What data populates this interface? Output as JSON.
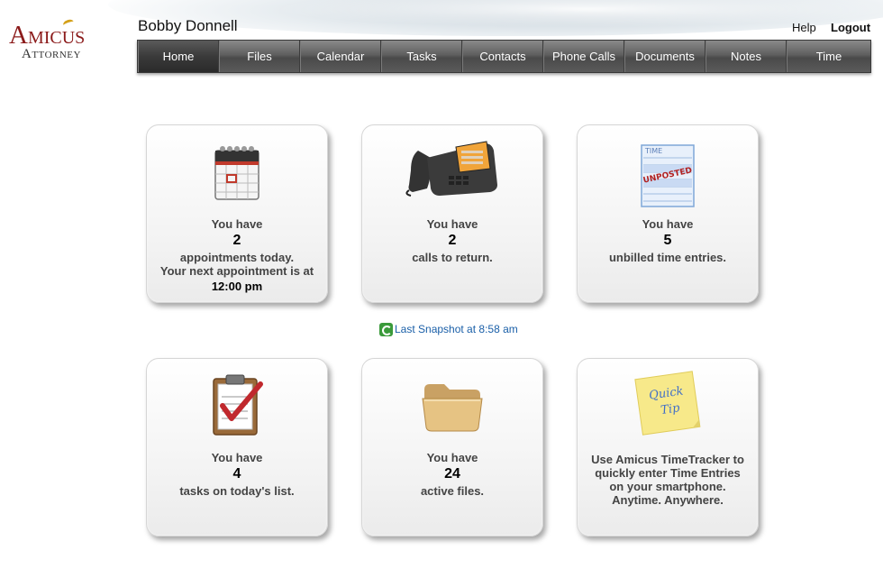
{
  "brand": {
    "logo_top": "Amicus",
    "logo_bottom": "Attorney"
  },
  "header": {
    "user_name": "Bobby Donnell",
    "help_label": "Help",
    "logout_label": "Logout"
  },
  "nav": {
    "active": "Home",
    "items": [
      "Home",
      "Files",
      "Calendar",
      "Tasks",
      "Contacts",
      "Phone Calls",
      "Documents",
      "Notes",
      "Time"
    ]
  },
  "cards": {
    "appointments": {
      "line1": "You have",
      "count": "2",
      "line2": "appointments today.",
      "line3": "Your next appointment is at",
      "time": "12:00 pm",
      "icon": "calendar-icon"
    },
    "calls": {
      "line1": "You have",
      "count": "2",
      "line2": "calls to return.",
      "icon": "desk-phone-icon"
    },
    "time_entries": {
      "line1": "You have",
      "count": "5",
      "line2": "unbilled time entries.",
      "icon": "unposted-time-sheet-icon",
      "sheet_title": "TIME",
      "stamp": "UNPOSTED"
    },
    "tasks": {
      "line1": "You have",
      "count": "4",
      "line2": "tasks on today's list.",
      "icon": "clipboard-check-icon"
    },
    "files": {
      "line1": "You have",
      "count": "24",
      "line2": "active files.",
      "icon": "folder-icon"
    },
    "tip": {
      "note_line1": "Quick",
      "note_line2": "Tip",
      "line1": "Use Amicus TimeTracker to",
      "line2": "quickly enter Time Entries",
      "line3": "on your smartphone.",
      "line4": "Anytime. Anywhere.",
      "icon": "sticky-note-icon"
    }
  },
  "snapshot": {
    "label": "Last Snapshot at 8:58 am",
    "icon": "refresh-icon"
  },
  "colors": {
    "brand_red": "#8b1a1a",
    "nav_dark": "#4a4a4a",
    "link_blue": "#1a5fa8",
    "refresh_green": "#3a9a3a"
  }
}
